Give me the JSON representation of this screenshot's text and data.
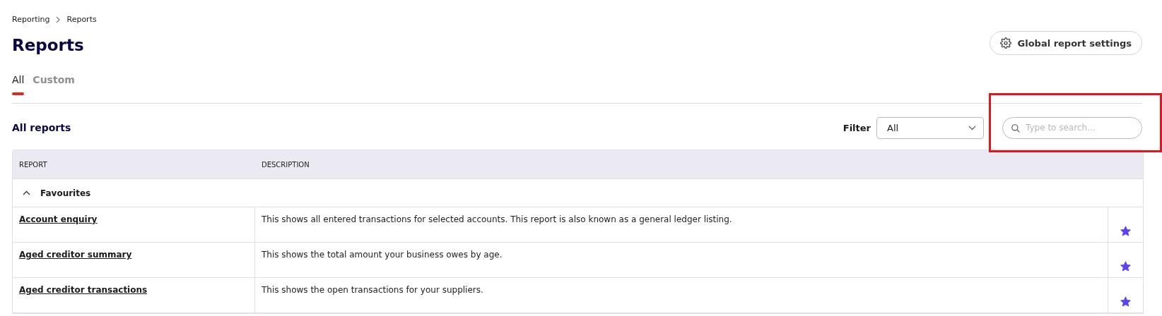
{
  "breadcrumb": [
    {
      "label": "Reporting"
    },
    {
      "label": "Reports"
    }
  ],
  "title": "Reports",
  "settings_button": {
    "label": "Global report settings"
  },
  "tabs": [
    {
      "label": "All",
      "selected": true
    },
    {
      "label": "Custom",
      "selected": false
    }
  ],
  "section_title": "All reports",
  "filter": {
    "label": "Filter",
    "value": "All"
  },
  "search": {
    "placeholder": "Type to search..."
  },
  "table": {
    "columns": [
      "REPORT",
      "DESCRIPTION"
    ],
    "group": {
      "label": "Favourites",
      "expanded": true
    },
    "rows": [
      {
        "report": "Account enquiry",
        "description": "This shows all entered transactions for selected accounts. This report is also known as a general ledger listing.",
        "favourite": true
      },
      {
        "report": "Aged creditor summary",
        "description": "This shows the total amount your business owes by age.",
        "favourite": true
      },
      {
        "report": "Aged creditor transactions",
        "description": "This shows the open transactions for your suppliers.",
        "favourite": true
      }
    ]
  }
}
